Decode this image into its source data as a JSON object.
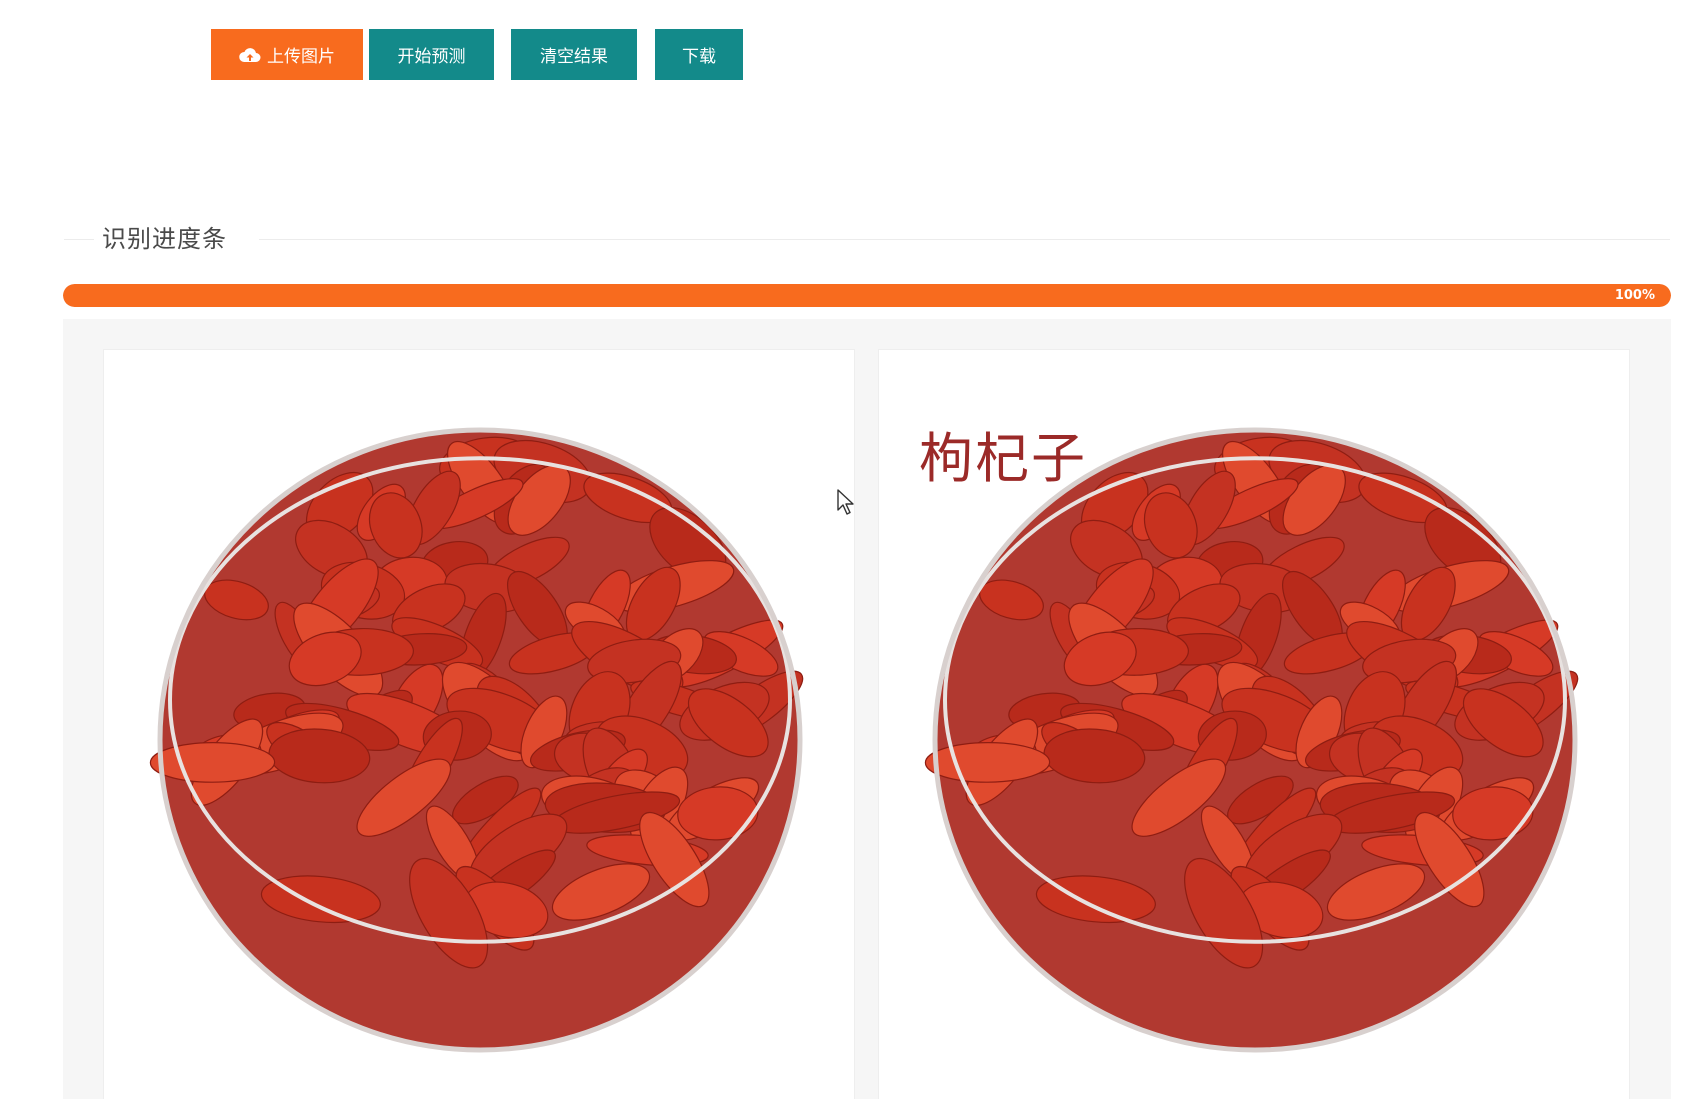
{
  "toolbar": {
    "upload_label": "上传图片",
    "predict_label": "开始预测",
    "clear_label": "清空结果",
    "download_label": "下载",
    "upload_icon": "cloud-upload-icon",
    "colors": {
      "upload": "#f86b1e",
      "action": "#138a8a"
    }
  },
  "progress": {
    "section_title": "识别进度条",
    "value": 100,
    "text": "100%",
    "color": "#f86b1e"
  },
  "results": {
    "source_image": "goji-berries-in-glass-bowl",
    "result_image": "goji-berries-in-glass-bowl-annotated",
    "prediction_label": "枸杞子"
  }
}
